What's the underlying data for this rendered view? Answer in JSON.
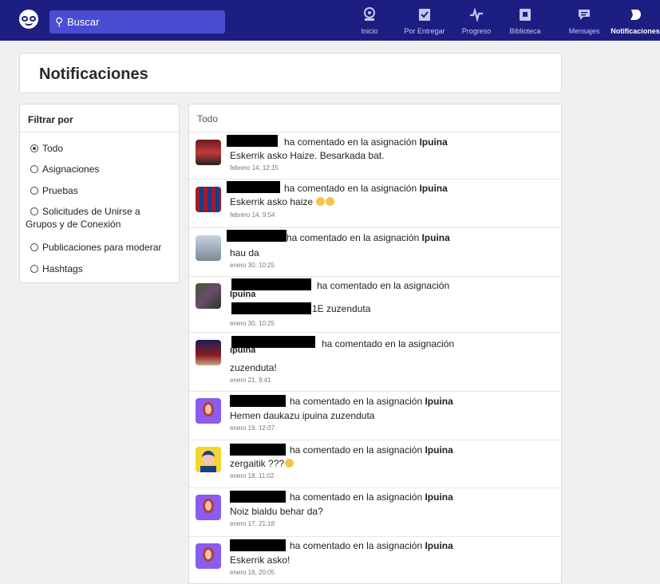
{
  "search": {
    "placeholder": "Buscar"
  },
  "nav": [
    {
      "label": "Inicio",
      "icon": "home-icon"
    },
    {
      "label": "Por Entregar",
      "icon": "clipboard-check-icon"
    },
    {
      "label": "Progreso",
      "icon": "pulse-icon"
    },
    {
      "label": "Biblioteca",
      "icon": "library-icon"
    },
    {
      "label": "Mensajes",
      "icon": "chat-icon"
    },
    {
      "label": "Notificaciones",
      "icon": "bell-icon",
      "active": true
    }
  ],
  "page_title": "Notificaciones",
  "filter": {
    "title": "Filtrar por",
    "options": [
      {
        "label": "Todo",
        "selected": true
      },
      {
        "label": "Asignaciones"
      },
      {
        "label": "Pruebas"
      },
      {
        "label": "Solicitudes de Unirse a Grupos y de Conexión"
      },
      {
        "label": "Publicaciones para moderar"
      },
      {
        "label": "Hashtags"
      }
    ]
  },
  "list": {
    "title": "Todo",
    "action_prefix": "ha comentado en la asignación",
    "assignment": "Ipuina",
    "items": [
      {
        "message": "Eskerrik asko Haize. Besarkada bat.",
        "time": "febrero 14, 12:15"
      },
      {
        "message": "Eskerrik asko haize",
        "time": "febrero 14, 9:54"
      },
      {
        "message": "hau da",
        "time": "enero 30, 10:25"
      },
      {
        "message": "1E zuzenduta",
        "time": "enero 30, 10:25"
      },
      {
        "message": "zuzenduta!",
        "time": "enero 21, 9:41"
      },
      {
        "message": "Hemen daukazu ipuina zuzenduta",
        "time": "enero 19, 12:07"
      },
      {
        "message": "zergaitik ???",
        "time": "enero 18, 11:02"
      },
      {
        "message": "Noiz bialdu behar da?",
        "time": "enero 17, 21:18"
      },
      {
        "message": "Eskerrik asko!",
        "time": "enero 16, 20:05"
      }
    ]
  }
}
